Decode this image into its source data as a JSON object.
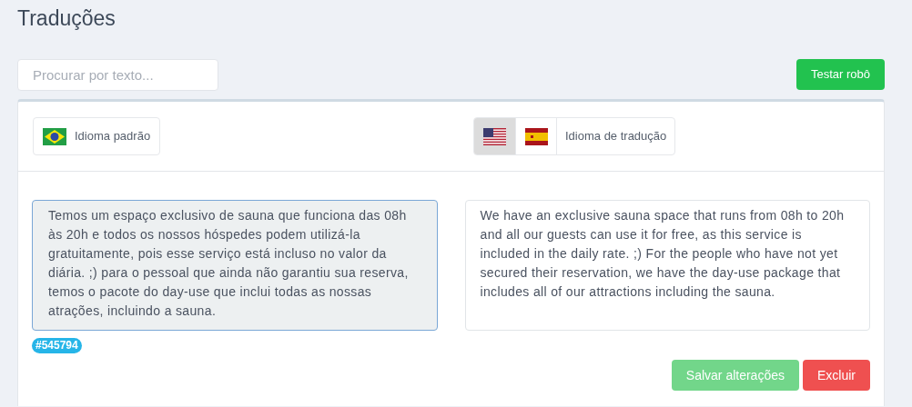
{
  "title": "Traduções",
  "search": {
    "placeholder": "Procurar por texto..."
  },
  "test_button": "Testar robô",
  "source_language": {
    "kind": "br",
    "label": "Idioma padrão"
  },
  "target_languages": [
    {
      "kind": "us",
      "selected": true
    },
    {
      "kind": "es",
      "selected": false
    }
  ],
  "target_label": "Idioma de tradução",
  "source_text": {
    "value": "Temos um espaço exclusivo de sauna que funciona das 08h às 20h e todos os nossos hóspedes podem utilizá-la gratuitamente, pois esse serviço está incluso no valor da diária. ;) para o pessoal que ainda não garantiu sua reserva, temos o pacote do day-use que inclui todas as nossas atrações, incluindo a sauna.",
    "focused": true
  },
  "target_text": {
    "value": "We have an exclusive sauna space that runs from 08h to 20h and all our guests can use it for free, as this service is included in the daily rate. ;) For the people who have not yet secured their reservation, we have the day-use package that includes all of our attractions including the sauna.",
    "focused": false
  },
  "tag": "#545794",
  "buttons": [
    {
      "label": "Salvar alterações",
      "kind": "save"
    },
    {
      "label": "Excluir",
      "kind": "delete"
    }
  ]
}
